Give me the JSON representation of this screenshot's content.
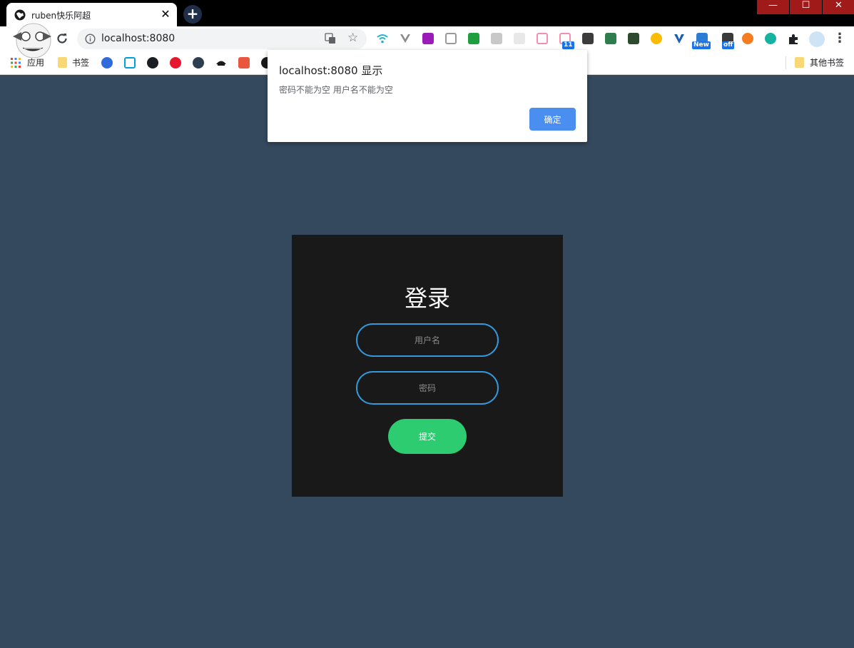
{
  "browser": {
    "tab": {
      "title": "ruben快乐阿超",
      "close_glyph": "✕"
    },
    "new_tab_glyph": "+",
    "window_controls": {
      "minimize": "—",
      "maximize": "☐",
      "close": "✕"
    },
    "address": {
      "url": "localhost:8080"
    },
    "menu_glyph": "⋮",
    "extension_badges": {
      "badge_11": "11",
      "badge_new": "New",
      "badge_off": "off"
    },
    "bookmarks": {
      "apps_label": "应用",
      "bookmarks_label": "书签",
      "other_label": "其他书签"
    }
  },
  "alert": {
    "heading": "localhost:8080 显示",
    "message": "密码不能为空 用户名不能为空",
    "ok_label": "确定"
  },
  "login": {
    "title": "登录",
    "username_placeholder": "用户名",
    "password_placeholder": "密码",
    "submit_label": "提交"
  },
  "colors": {
    "page_background": "#34495e",
    "card_background": "#191919",
    "input_border": "#3498db",
    "submit_button": "#2ecc71",
    "alert_button": "#4a8ef0"
  }
}
